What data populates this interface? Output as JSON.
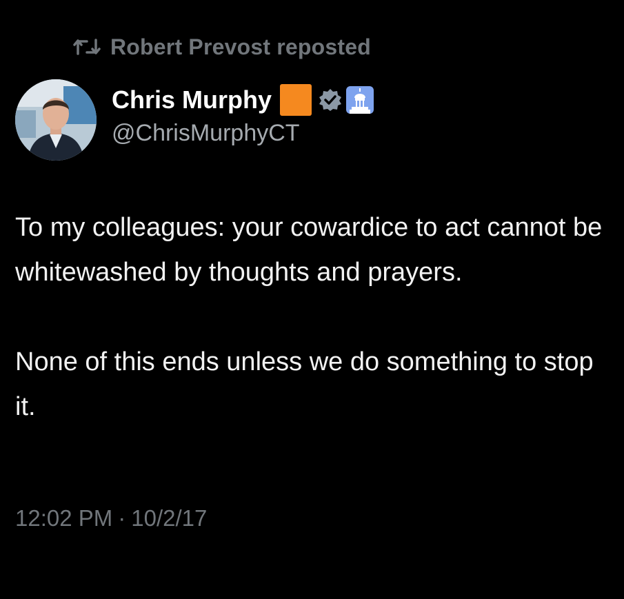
{
  "repost": {
    "icon": "repost-icon",
    "label": "Robert Prevost reposted"
  },
  "author": {
    "display_name": "Chris Murphy",
    "handle": "@ChrisMurphyCT",
    "emoji": "orange-square",
    "emoji_color": "#f5891f",
    "verified_icon": "verified-badge-icon",
    "verified_color": "#8b98a5",
    "affiliation_icon": "capitol-building-icon",
    "affiliation_bg": "#7ea3ee",
    "avatar": "avatar"
  },
  "tweet": {
    "paragraph_1": "To my colleagues: your cowardice to act cannot be whitewashed by thoughts and prayers.",
    "paragraph_2": "None of this ends unless we do something to stop it."
  },
  "meta": {
    "time": "12:02 PM",
    "separator": "·",
    "date": "10/2/17"
  },
  "theme": {
    "background": "#000000",
    "text": "#e7e9ea",
    "muted": "#71767b"
  }
}
